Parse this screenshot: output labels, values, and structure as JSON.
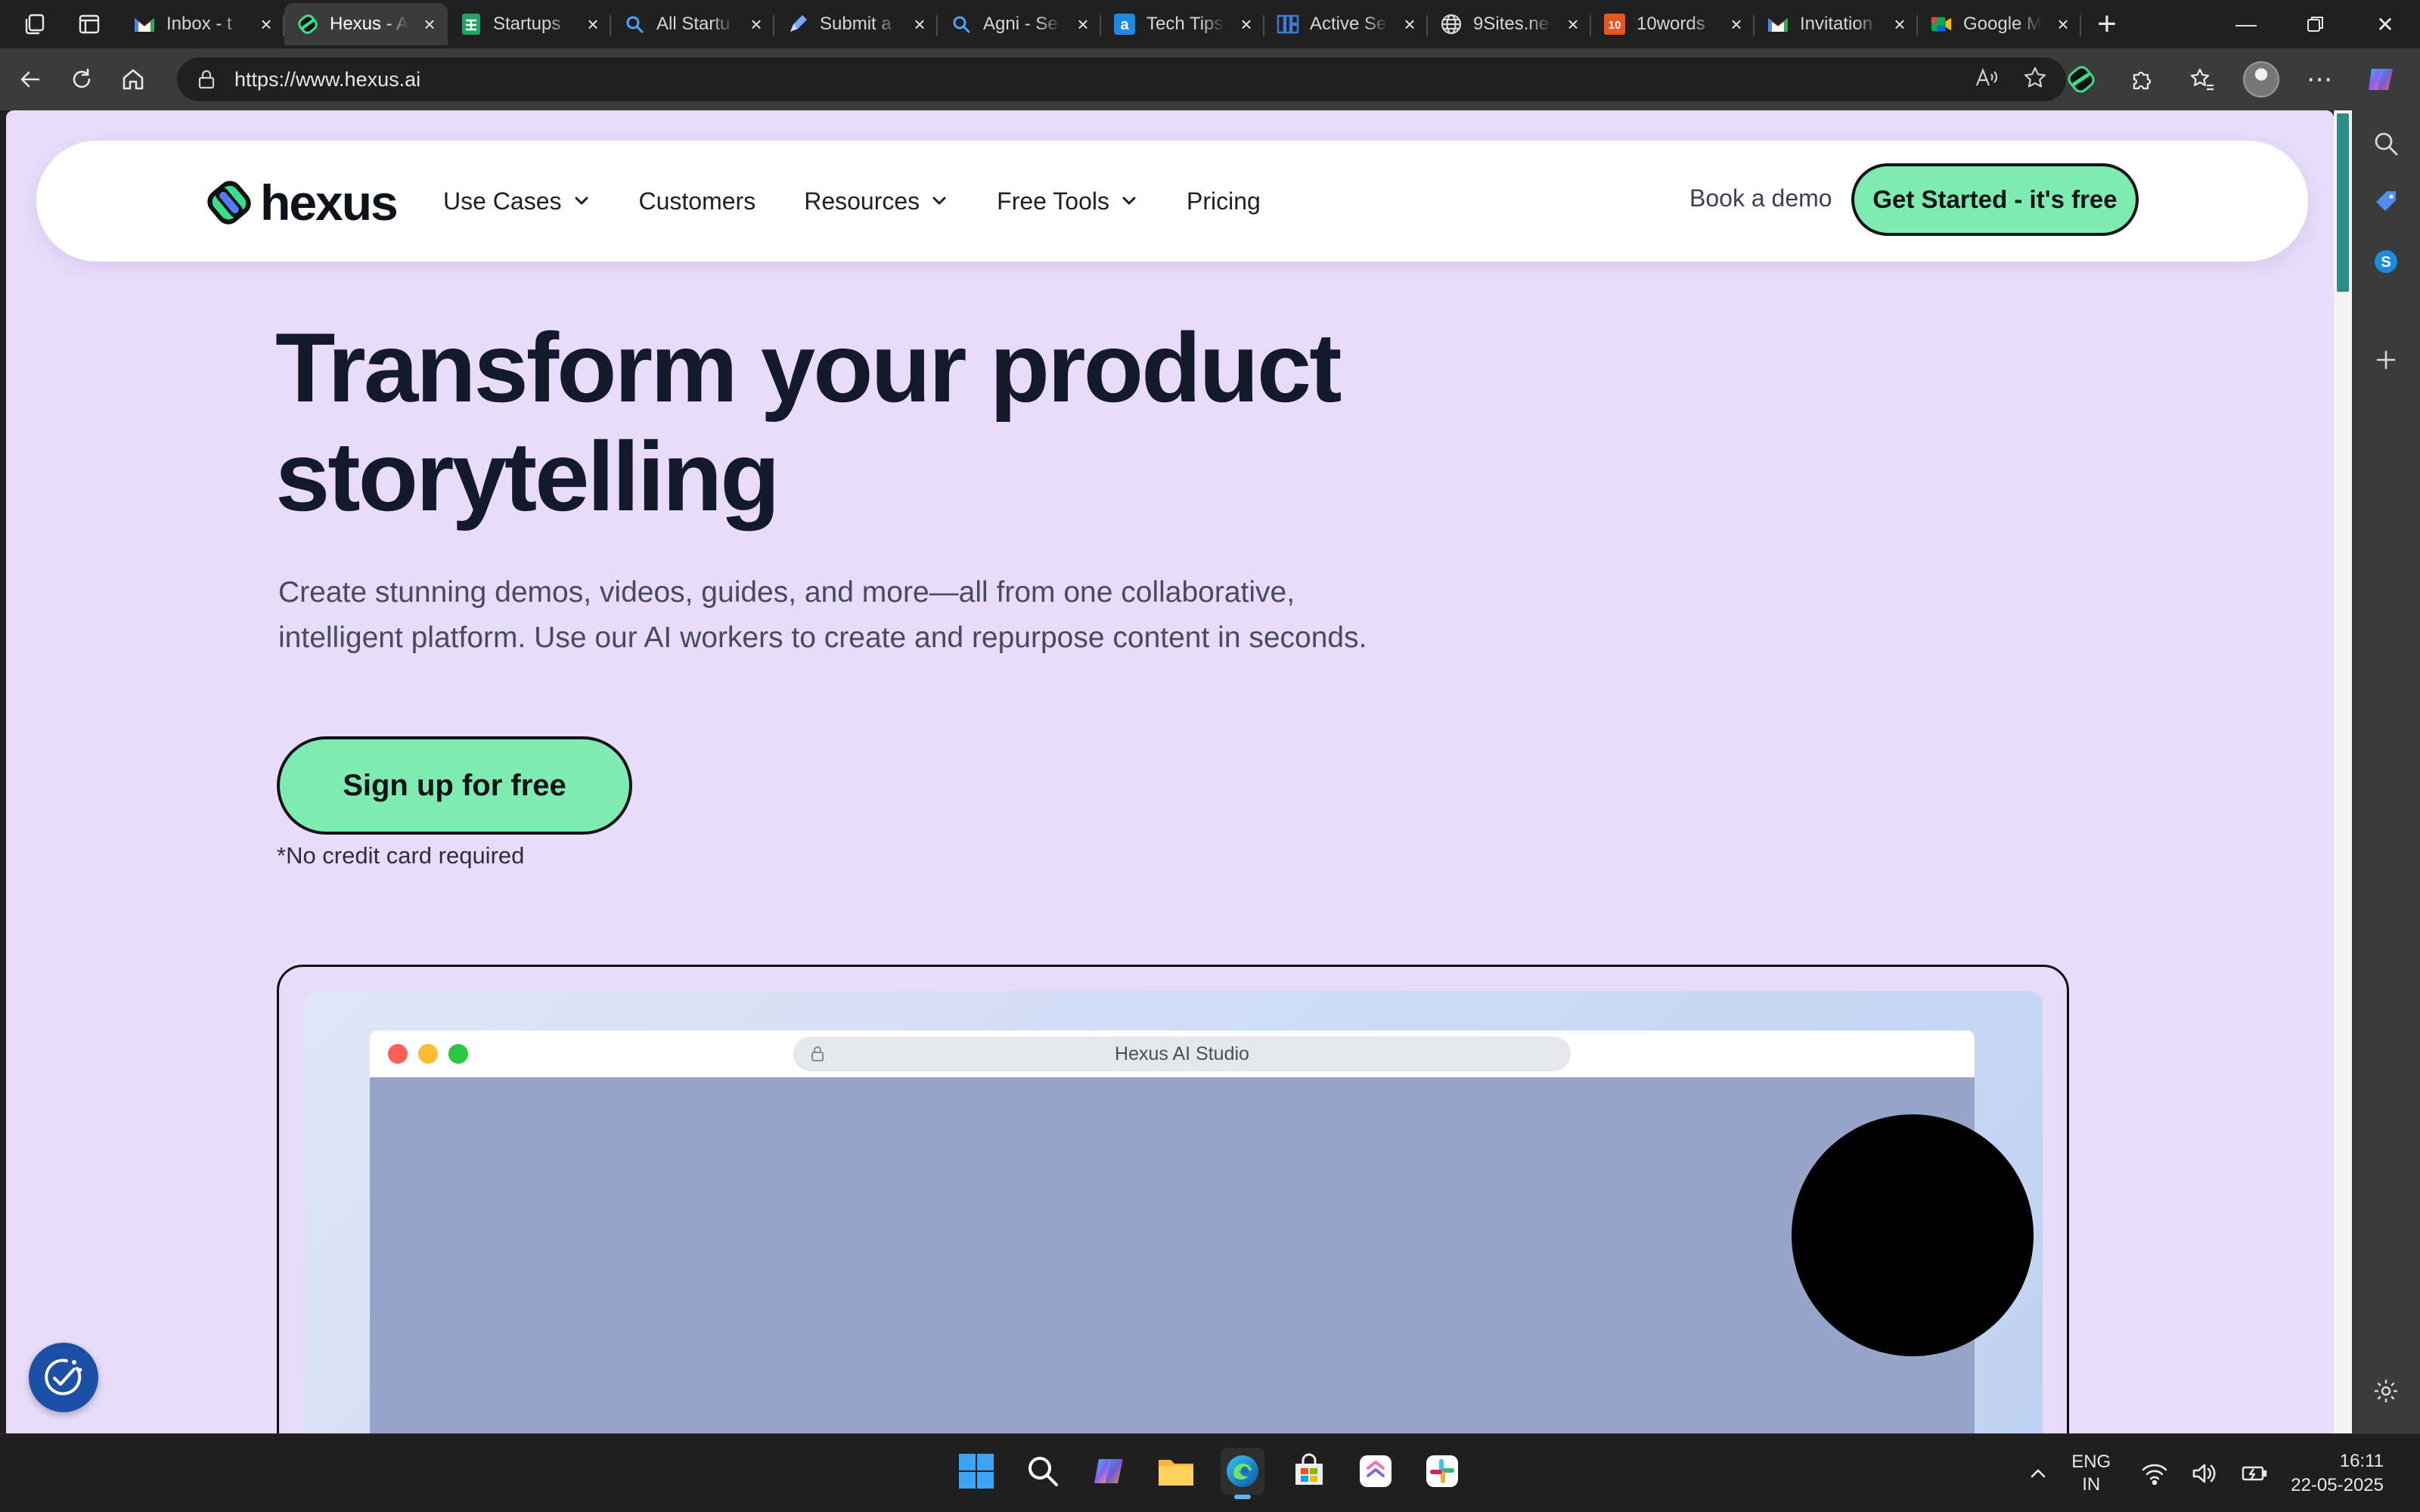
{
  "browser": {
    "tabs": [
      {
        "label": "Inbox - t",
        "icon": "gmail-icon",
        "color": "#ea4335",
        "active": false
      },
      {
        "label": "Hexus - A",
        "icon": "hexus-icon",
        "color": "#36e08a",
        "active": true
      },
      {
        "label": "Startups",
        "icon": "sheets-icon",
        "color": "#1fa463",
        "active": false
      },
      {
        "label": "All Startu",
        "icon": "search-icon",
        "color": "#4aa3ff",
        "active": false
      },
      {
        "label": "Submit a",
        "icon": "pen-icon",
        "color": "#7aa7ff",
        "active": false
      },
      {
        "label": "Agni - Se",
        "icon": "search-icon",
        "color": "#4aa3ff",
        "active": false
      },
      {
        "label": "Tech Tips",
        "icon": "a-icon",
        "color": "#1e88e5",
        "active": false
      },
      {
        "label": "Active Se",
        "icon": "grid-icon",
        "color": "#3d7bd9",
        "active": false
      },
      {
        "label": "9Sites.ne",
        "icon": "globe-icon",
        "color": "#cccccc",
        "active": false
      },
      {
        "label": "10words",
        "icon": "ten-icon",
        "color": "#e8561e",
        "active": false
      },
      {
        "label": "Invitation",
        "icon": "gmail-icon",
        "color": "#ea4335",
        "active": false
      },
      {
        "label": "Google M",
        "icon": "meet-icon",
        "color": "#00ac47",
        "active": false
      }
    ],
    "address": {
      "url": "https://www.hexus.ai"
    }
  },
  "site": {
    "logo_text": "hexus",
    "nav": {
      "use_cases": "Use Cases",
      "customers": "Customers",
      "resources": "Resources",
      "free_tools": "Free Tools",
      "pricing": "Pricing",
      "book_demo": "Book a demo",
      "get_started": "Get Started - it's free"
    },
    "hero": {
      "title_line1": "Transform your product",
      "title_line2": "storytelling",
      "subtitle_line1": "Create stunning demos, videos, guides, and more—all from one collaborative,",
      "subtitle_line2": "intelligent platform. Use our AI workers to create and repurpose content in seconds.",
      "cta": "Sign up for free",
      "note": "*No credit card required"
    },
    "demo": {
      "window_title": "Hexus AI Studio"
    },
    "colors": {
      "background": "#e8dcfa",
      "accent": "#7eecb0",
      "ink": "#131a2c"
    }
  },
  "taskbar": {
    "apps": [
      "windows-start-icon",
      "search-icon",
      "copilot-icon",
      "file-explorer-icon",
      "edge-icon",
      "store-icon",
      "clickup-icon",
      "slack-icon"
    ],
    "lang_line1": "ENG",
    "lang_line2": "IN",
    "time": "16:11",
    "date": "22-05-2025"
  }
}
